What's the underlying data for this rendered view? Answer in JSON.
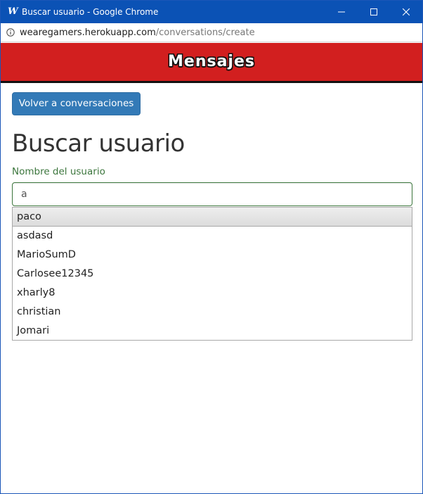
{
  "window": {
    "title": "Buscar usuario - Google Chrome",
    "app_icon_glyph": "W",
    "controls": [
      "minimize-icon",
      "maximize-icon",
      "close-icon"
    ]
  },
  "address_bar": {
    "host": "wearegamers.herokuapp.com",
    "path": "/conversations/create",
    "icon": "info-icon"
  },
  "banner": {
    "brand": "Mensajes"
  },
  "page": {
    "back_button": "Volver a conversaciones",
    "title": "Buscar usuario",
    "field_label": "Nombre del usuario",
    "search_value": "a"
  },
  "suggestions": [
    "paco",
    "asdasd",
    "MarioSumD",
    "Carlosee12345",
    "xharly8",
    "christian",
    "Jomari"
  ],
  "colors": {
    "titlebar": "#0b52b5",
    "banner": "#d21f1f",
    "primary_button": "#337ab7",
    "success_label": "#3c763d"
  }
}
